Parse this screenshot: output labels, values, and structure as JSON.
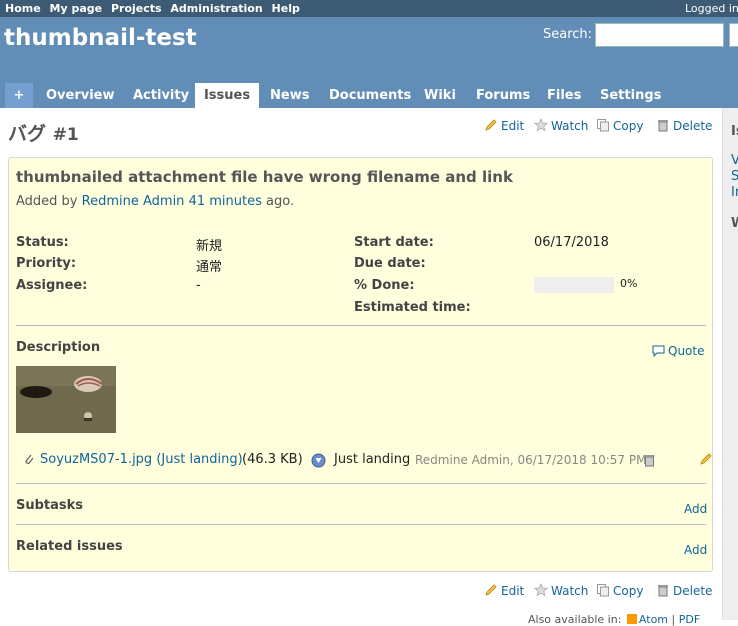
{
  "top_menu": {
    "items": [
      "Home",
      "My page",
      "Projects",
      "Administration",
      "Help"
    ],
    "logged_in": "Logged in"
  },
  "header": {
    "project_title": "thumbnail-test",
    "search_label": "Search:",
    "search_value": ""
  },
  "main_menu": {
    "new_label": "+",
    "tabs": [
      "Overview",
      "Activity",
      "Issues",
      "News",
      "Documents",
      "Wiki",
      "Forums",
      "Files",
      "Settings"
    ],
    "selected": "Issues"
  },
  "issue": {
    "tracker": "バグ",
    "number": "#1",
    "subject": "thumbnailed attachment file have wrong filename and link",
    "added_by_prefix": "Added by",
    "author": "Redmine Admin",
    "age": "41 minutes",
    "age_suffix": "ago.",
    "attributes": {
      "status_label": "Status:",
      "status": "新規",
      "priority_label": "Priority:",
      "priority": "通常",
      "assignee_label": "Assignee:",
      "assignee": "-",
      "start_label": "Start date:",
      "start": "06/17/2018",
      "due_label": "Due date:",
      "due": "",
      "done_label": "% Done:",
      "done": "0%",
      "done_value": 0,
      "estimated_label": "Estimated time:",
      "estimated": ""
    },
    "description_title": "Description",
    "quote": "Quote",
    "attachment": {
      "filename": "SoyuzMS07-1.jpg (Just landing)",
      "size": "(46.3 KB)",
      "description": "Just landing",
      "author_date": "Redmine Admin, 06/17/2018 10:57 PM"
    },
    "subtasks_title": "Subtasks",
    "subtasks_add": "Add",
    "related_title": "Related issues",
    "related_add": "Add"
  },
  "actions": {
    "edit": "Edit",
    "watch": "Watch",
    "copy": "Copy",
    "delete": "Delete"
  },
  "footer": {
    "also_available": "Also available in:",
    "atom": "Atom",
    "pdf": "PDF"
  },
  "sidebar": {
    "frag1": "Is",
    "frag2": "V",
    "frag3": "S",
    "frag4": "In",
    "frag5": "W"
  }
}
